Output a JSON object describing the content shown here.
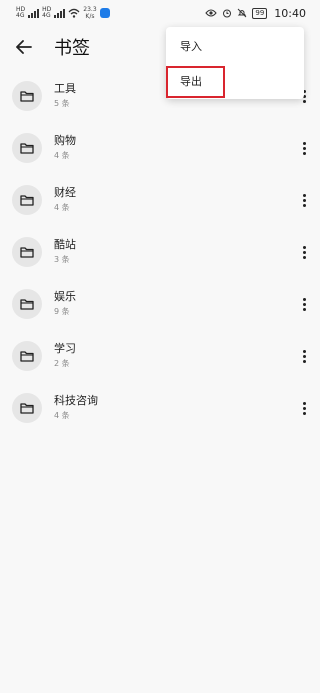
{
  "status_bar": {
    "left_tiny_1": "HD",
    "left_tiny_2": "4G",
    "left_tiny_3": "HD",
    "left_tiny_4": "4G",
    "speed_value": "23.3",
    "speed_unit": "K/s",
    "battery": "99",
    "time": "10:40"
  },
  "app_bar": {
    "title": "书签"
  },
  "menu": {
    "items": [
      {
        "label": "导入"
      },
      {
        "label": "导出"
      }
    ]
  },
  "bookmarks": [
    {
      "title": "工具",
      "count": "5 条"
    },
    {
      "title": "购物",
      "count": "4 条"
    },
    {
      "title": "财经",
      "count": "4 条"
    },
    {
      "title": "酷站",
      "count": "3 条"
    },
    {
      "title": "娱乐",
      "count": "9 条"
    },
    {
      "title": "学习",
      "count": "2 条"
    },
    {
      "title": "科技咨询",
      "count": "4 条"
    }
  ],
  "colors": {
    "highlight": "#d9252e",
    "background": "#f8f8f8",
    "app_icon": "#1e7ce8"
  }
}
